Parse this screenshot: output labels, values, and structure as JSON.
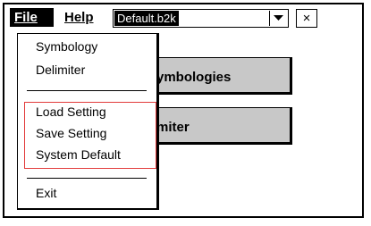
{
  "menubar": {
    "file_label": "File",
    "help_label": "Help"
  },
  "combo": {
    "value": "Default.b2k"
  },
  "close_label": "×",
  "background": {
    "button1_label": "ymbologies",
    "button2_label": "miter"
  },
  "file_menu": {
    "items": [
      {
        "label": "Symbology"
      },
      {
        "label": "Delimiter"
      },
      {
        "label": "Load Setting"
      },
      {
        "label": "Save Setting"
      },
      {
        "label": "System Default"
      },
      {
        "label": "Exit"
      }
    ]
  },
  "colors": {
    "highlight_box": "#e23b3b",
    "button_face": "#c8c8c8"
  }
}
